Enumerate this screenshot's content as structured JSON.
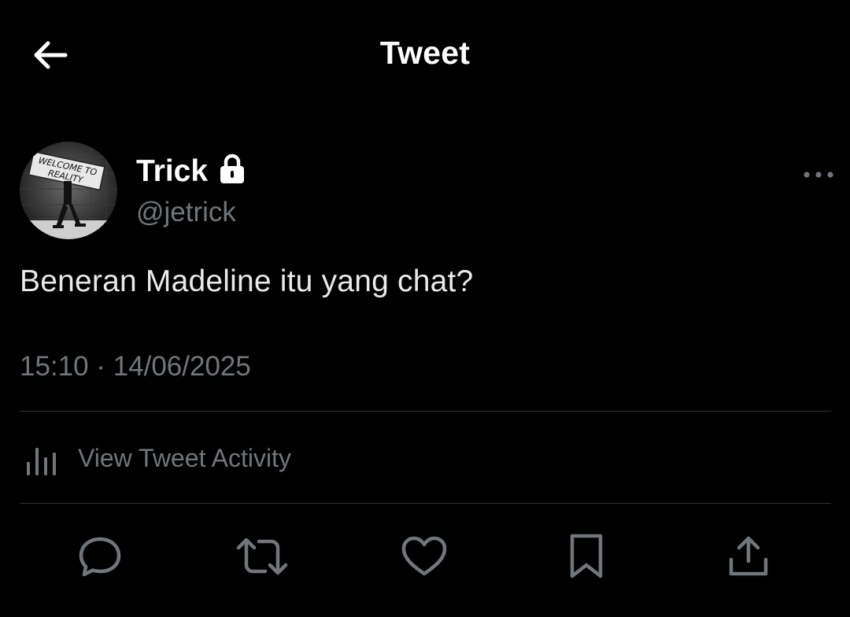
{
  "header": {
    "title": "Tweet",
    "back_icon": "arrow-left-icon"
  },
  "author": {
    "display_name": "Trick",
    "handle": "@jetrick",
    "protected_icon": "lock-icon",
    "avatar_text": "WELCOME TO REALITY"
  },
  "tweet": {
    "text": "Beneran Madeline itu yang chat?",
    "timestamp": "15:10 · 14/06/2025"
  },
  "activity": {
    "label": "View Tweet Activity",
    "icon": "bar-chart-icon"
  },
  "actions": {
    "reply_icon": "reply-icon",
    "retweet_icon": "retweet-icon",
    "like_icon": "heart-icon",
    "bookmark_icon": "bookmark-icon",
    "share_icon": "share-icon"
  },
  "colors": {
    "background": "#000000",
    "primary_text": "#e7e9ea",
    "secondary_text": "#71767b",
    "divider": "#2f3336",
    "icon": "#71767b"
  }
}
